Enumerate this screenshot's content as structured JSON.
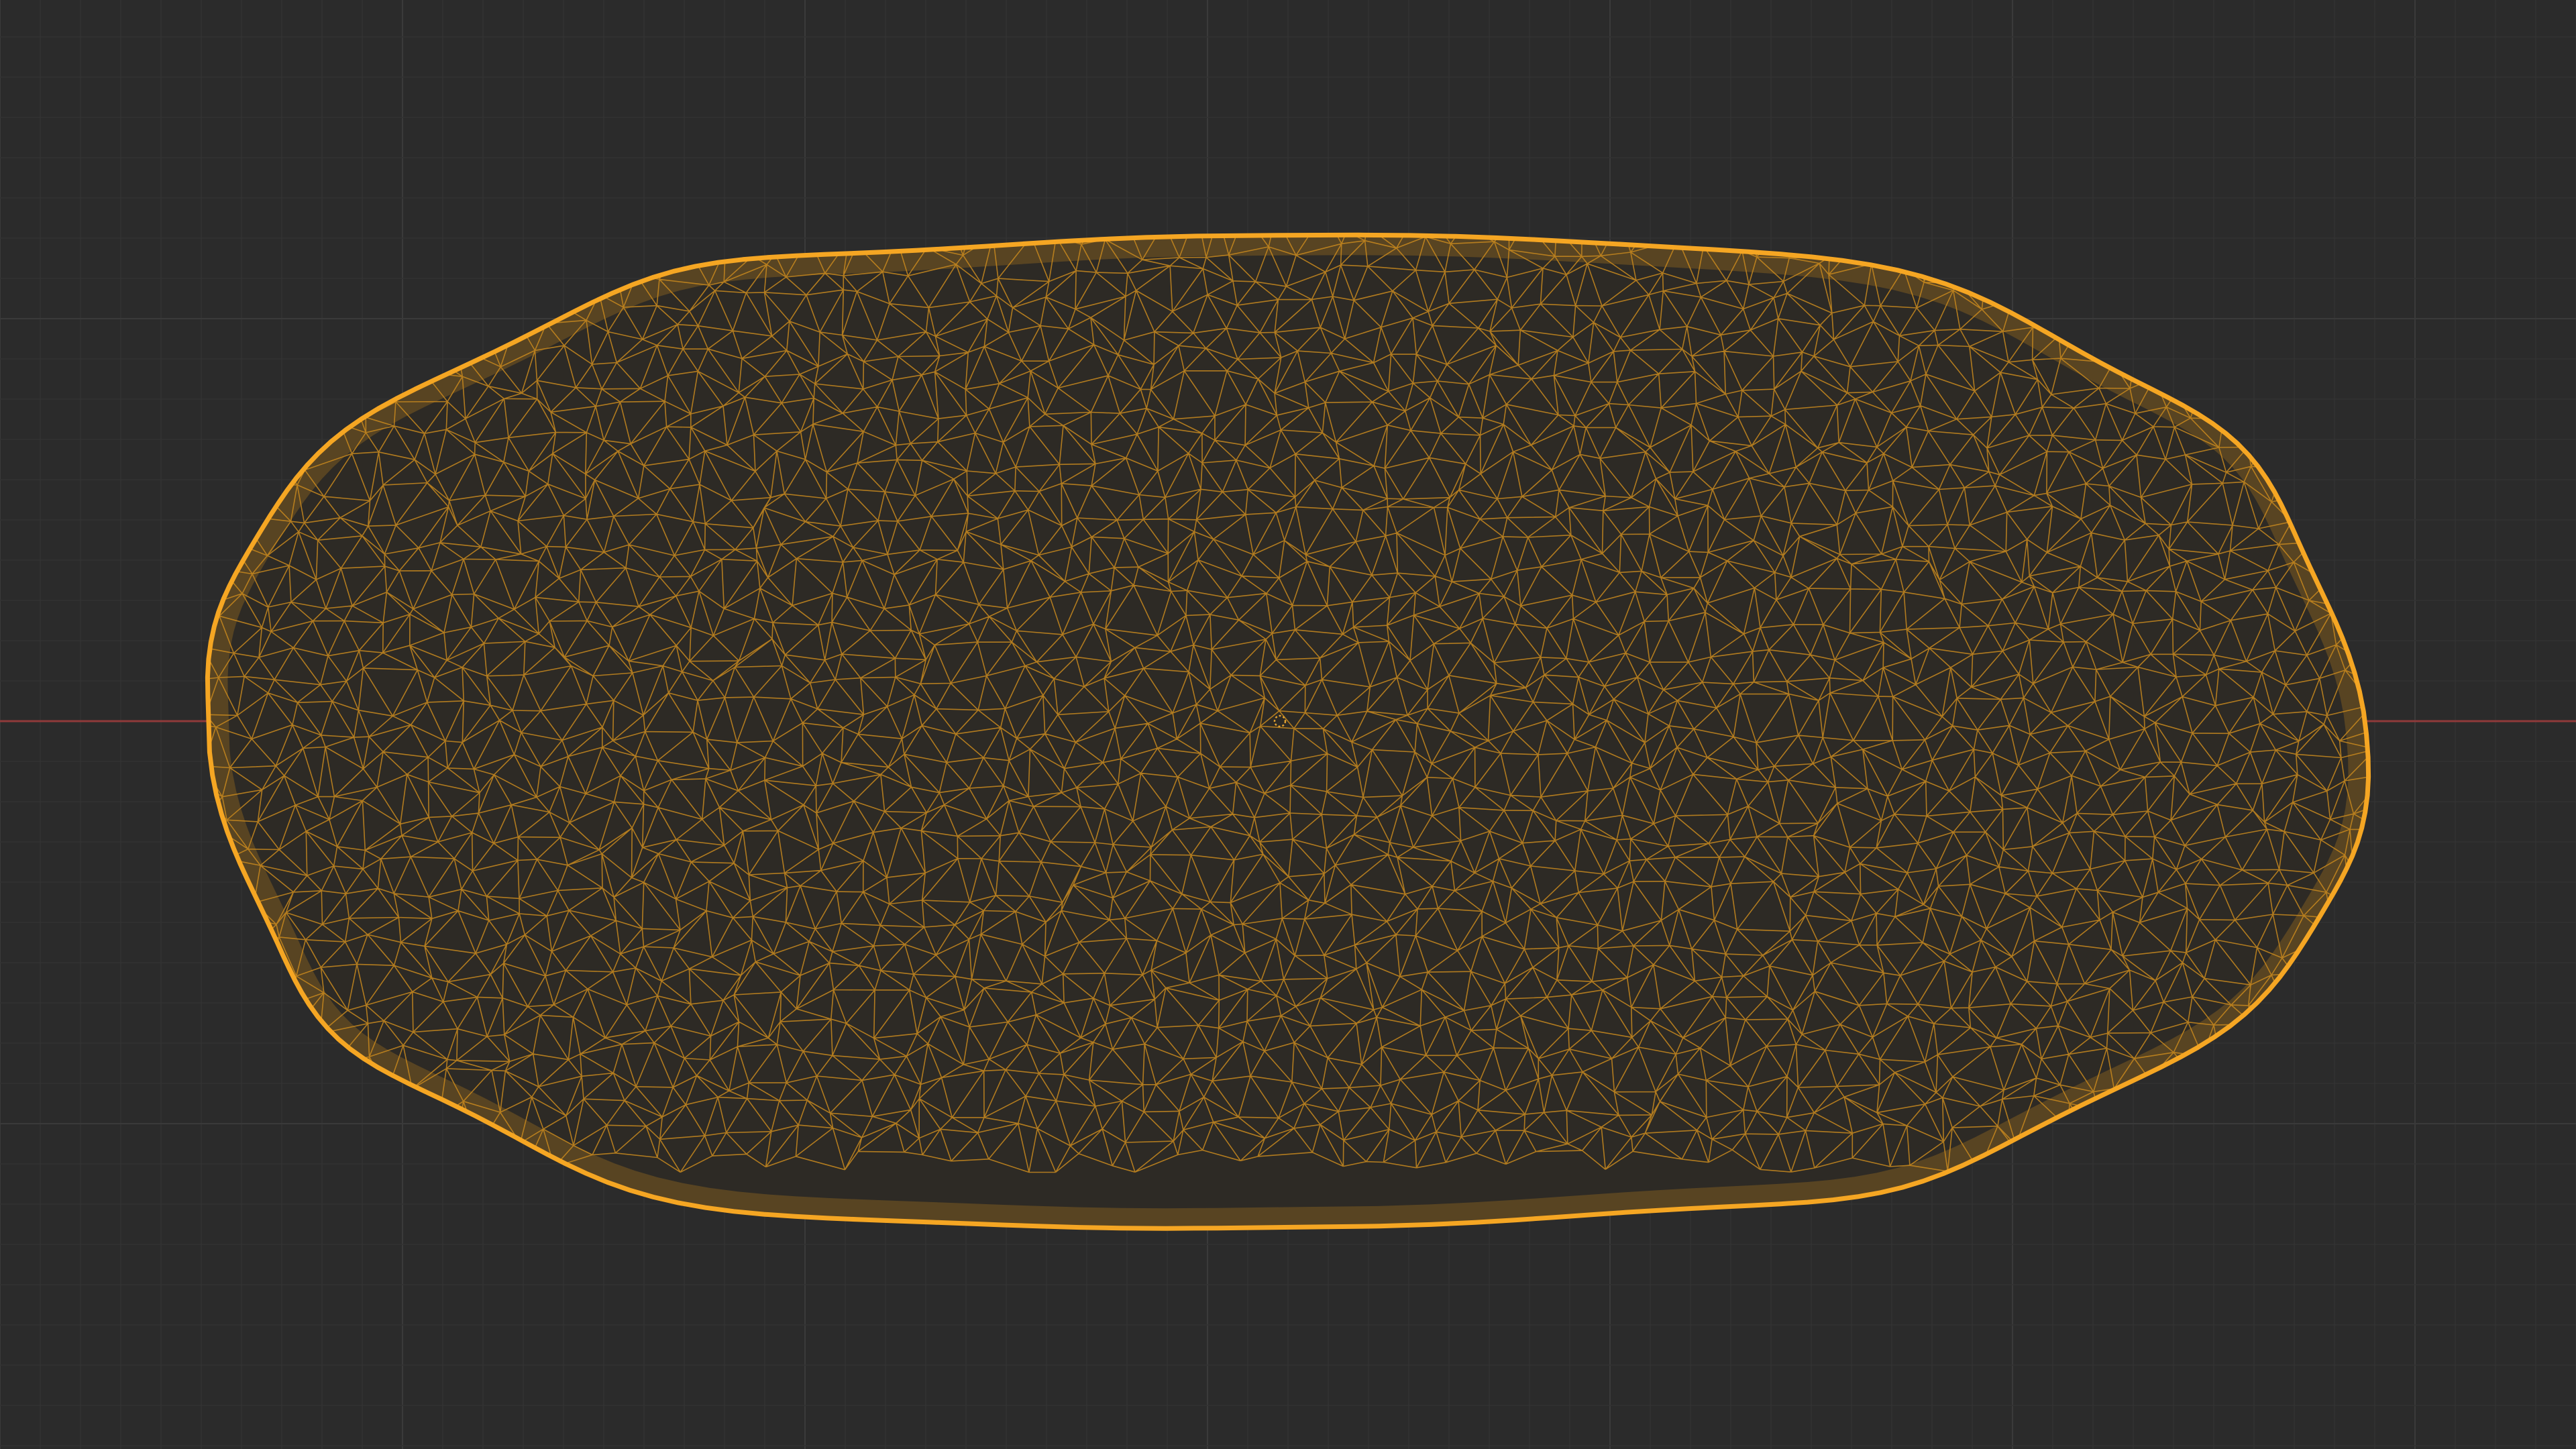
{
  "viewport": {
    "background_color": "#2b2b2b",
    "grid_minor_color": "#333333",
    "grid_major_color": "#3a3a3a",
    "x_axis_color": "#8f3a3a",
    "object_origin_color": "#e0a030"
  },
  "selected_object": {
    "display_mode": "wireframe",
    "outline_color": "#f5a623",
    "edge_color": "#c98a1e",
    "shape": "elongated-ellipsoid"
  }
}
